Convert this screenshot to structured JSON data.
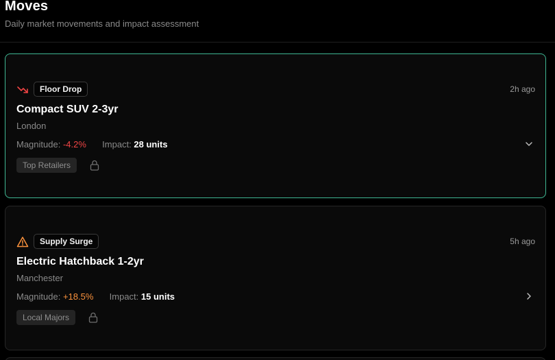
{
  "header": {
    "title": "Moves",
    "subtitle": "Daily market movements and impact assessment"
  },
  "moves": [
    {
      "type_icon": "trending-down-icon",
      "type_label": "Floor Drop",
      "time_ago": "2h ago",
      "name": "Compact SUV 2-3yr",
      "location": "London",
      "magnitude_label": "Magnitude:",
      "magnitude_value": "-4.2%",
      "impact_label": "Impact:",
      "impact_value": "28 units",
      "tag": "Top Retailers",
      "expanded_icon": "chevron-down-icon",
      "selected": true,
      "accent_color": "#ef4444"
    },
    {
      "type_icon": "warning-triangle-icon",
      "type_label": "Supply Surge",
      "time_ago": "5h ago",
      "name": "Electric Hatchback 1-2yr",
      "location": "Manchester",
      "magnitude_label": "Magnitude:",
      "magnitude_value": "+18.5%",
      "impact_label": "Impact:",
      "impact_value": "15 units",
      "tag": "Local Majors",
      "expanded_icon": "chevron-right-icon",
      "selected": false,
      "accent_color": "#fb923c"
    }
  ],
  "colors": {
    "selected_border": "#3fb894",
    "card_border": "#262626",
    "background": "#000000"
  }
}
